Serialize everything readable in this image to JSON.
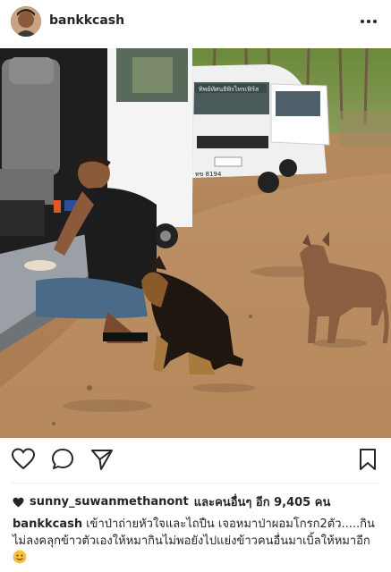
{
  "post": {
    "username": "bankkcash",
    "likes_user": "sunny_suwanmethanont",
    "likes_rest": "และคนอื่นๆ อีก 9,405 คน",
    "caption_text": "เข้าป่าถ่ายหัวใจและไถปืน เจอหมาป่าผอมโกรก2ตัว.....กินไม่ลงคลุกข้าวตัวเองให้หมากินไม่พอยังไปแย่งข้าวคนอื่นมาเบิ้ลให้หมาอีก",
    "van_plate_text": "ทิพย์ทัศนธิพิรไทรเฟิร์ส",
    "van_plate_number": "ทข 8194"
  },
  "icons": {
    "more": "more-dots-icon",
    "like": "heart-outline-icon",
    "comment": "comment-icon",
    "share": "send-icon",
    "save": "bookmark-icon",
    "likes_heart": "heart-filled-icon",
    "emoji": "smiling-face-emoji"
  },
  "colors": {
    "text": "#262626",
    "divider": "#efefef",
    "emoji": "#f7c23c"
  }
}
